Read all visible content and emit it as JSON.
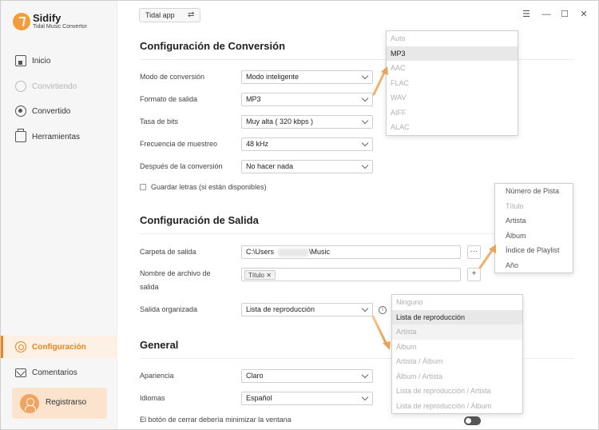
{
  "app": {
    "name": "Sidify",
    "subtitle": "Tidal Music Convertor"
  },
  "sidebar": {
    "items": [
      {
        "label": "Inicio",
        "icon": "home-icon"
      },
      {
        "label": "Convirtiendo",
        "icon": "converting-icon"
      },
      {
        "label": "Convertido",
        "icon": "converted-icon"
      },
      {
        "label": "Herramientas",
        "icon": "toolbox-icon"
      },
      {
        "label": "Configuración",
        "icon": "settings-icon"
      },
      {
        "label": "Comentarios",
        "icon": "mail-icon"
      }
    ],
    "register_label": "Registrarso"
  },
  "topbar": {
    "source": "Tidal app",
    "swap_icon": "swap-icon",
    "window_controls": [
      "menu-icon",
      "minimize-icon",
      "maximize-icon",
      "close-icon"
    ]
  },
  "conversion": {
    "title": "Configuración de Conversión",
    "rows": [
      {
        "label": "Modo de conversión",
        "value": "Modo inteligente"
      },
      {
        "label": "Formato de salida",
        "value": "MP3"
      },
      {
        "label": "Tasa de bits",
        "value": "Muy alta ( 320 kbps )"
      },
      {
        "label": "Frecuencia de muestreo",
        "value": "48 kHz"
      },
      {
        "label": "Después de la conversión",
        "value": "No hacer nada"
      }
    ],
    "save_lyrics": "Guardar letras (si están disponibles)"
  },
  "output": {
    "title": "Configuración de Salida",
    "folder_label": "Carpeta de salida",
    "folder_prefix": "C:\\Users",
    "folder_suffix": "\\Music",
    "browse_label": "···",
    "filename_label_1": "Nombre de archivo de",
    "filename_label_2": "salida",
    "filename_tag": "Título",
    "add_label": "+",
    "organized_label": "Salida organizada",
    "organized_value": "Lista de reproducción"
  },
  "general": {
    "title": "General",
    "appearance_label": "Apariencia",
    "appearance_value": "Claro",
    "language_label": "Idiomas",
    "language_value": "Español",
    "close_label": "El botón de cerrar debería minimizar la ventana"
  },
  "format_dropdown": [
    "Auto",
    "MP3",
    "AAC",
    "FLAC",
    "WAV",
    "AIFF",
    "ALAC"
  ],
  "filename_dropdown": [
    "Número de Pista",
    "Título",
    "Artista",
    "Álbum",
    "Índice de Playlist",
    "Año"
  ],
  "organized_dropdown": [
    "Ninguno",
    "Lista de reproducción",
    "Artista",
    "Álbum",
    "Artista / Álbum",
    "Álbum / Artista",
    "Lista de reproducción / Artista",
    "Lista de reproducción / Álbum"
  ],
  "colors": {
    "accent": "#e8861f",
    "accent_light": "#fbe3cd"
  }
}
